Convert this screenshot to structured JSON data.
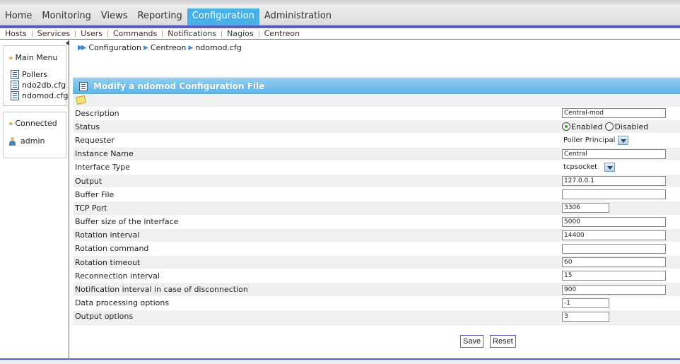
{
  "top_menu": [
    {
      "label": "Home"
    },
    {
      "label": "Monitoring"
    },
    {
      "label": "Views"
    },
    {
      "label": "Reporting"
    },
    {
      "label": "Configuration",
      "active": true
    },
    {
      "label": "Administration"
    }
  ],
  "sub_menu": [
    "Hosts",
    "Services",
    "Users",
    "Commands",
    "Notifications",
    "Nagios",
    "Centreon"
  ],
  "sidebar": {
    "main_menu_title": "Main Menu",
    "items": [
      {
        "label": "Pollers",
        "icon": "file-icon"
      },
      {
        "label": "ndo2db.cfg",
        "icon": "file-icon"
      },
      {
        "label": "ndomod.cfg",
        "icon": "file-icon"
      }
    ],
    "connected_title": "Connected",
    "user": {
      "label": "admin",
      "icon": "user-icon"
    }
  },
  "breadcrumb": [
    "Configuration",
    "Centreon",
    "ndomod.cfg"
  ],
  "panel": {
    "title": "Modify a ndomod Configuration File"
  },
  "form": {
    "description": {
      "label": "Description",
      "value": "Central-mod"
    },
    "status": {
      "label": "Status",
      "options": [
        "Enabled",
        "Disabled"
      ],
      "selected": "Enabled"
    },
    "requester": {
      "label": "Requester",
      "value": "Poller Principal"
    },
    "instance_name": {
      "label": "Instance Name",
      "value": "Central"
    },
    "interface_type": {
      "label": "Interface Type",
      "value": "tcpsocket"
    },
    "output": {
      "label": "Output",
      "value": "127.0.0.1"
    },
    "buffer_file": {
      "label": "Buffer File",
      "value": ""
    },
    "tcp_port": {
      "label": "TCP Port",
      "value": "3306"
    },
    "buffer_size": {
      "label": "Buffer size of the interface",
      "value": "5000"
    },
    "rotation_interval": {
      "label": "Rotation interval",
      "value": "14400"
    },
    "rotation_command": {
      "label": "Rotation command",
      "value": ""
    },
    "rotation_timeout": {
      "label": "Rotation timeout",
      "value": "60"
    },
    "reconnection_interval": {
      "label": "Reconnection interval",
      "value": "15"
    },
    "notification_interval": {
      "label": "Notification interval in case of disconnection",
      "value": "900"
    },
    "data_processing_options": {
      "label": "Data processing options",
      "value": "-1"
    },
    "output_options": {
      "label": "Output options",
      "value": "3"
    }
  },
  "buttons": {
    "save": "Save",
    "reset": "Reset"
  },
  "colors": {
    "accent": "#5b5fc8",
    "active_menu": "#48b0e6",
    "panel_header": "#5fb4e3"
  }
}
